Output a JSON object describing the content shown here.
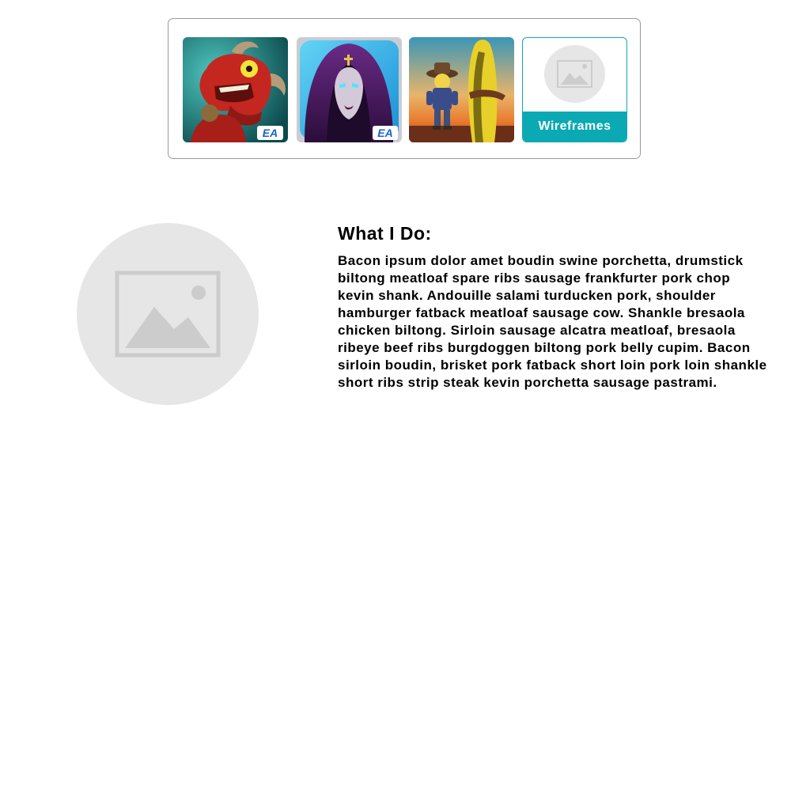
{
  "portfolio": {
    "tiles": [
      {
        "icon": "red-demon-game-icon",
        "badge": "EA"
      },
      {
        "icon": "hooded-woman-game-icon",
        "badge": "EA"
      },
      {
        "icon": "cowboy-game-icon"
      },
      {
        "icon": "image-placeholder-icon",
        "label": "Wireframes"
      }
    ]
  },
  "about": {
    "heading": "What I Do:",
    "body": "Bacon ipsum dolor amet boudin swine porchetta, drumstick biltong meatloaf spare ribs sausage frankfurter pork chop kevin shank. Andouille salami turducken pork, shoulder hamburger fatback meatloaf sausage cow. Shankle bresaola chicken biltong. Sirloin sausage alcatra meatloaf, bresaola ribeye beef ribs burgdoggen biltong pork belly cupim. Bacon sirloin boudin, brisket pork fatback short loin pork loin shankle short ribs strip steak kevin porchetta sausage pastrami."
  },
  "colors": {
    "accent": "#0aa9b4",
    "placeholder": "#e6e6e6",
    "placeholder_glyph": "#cccccc",
    "border": "#9a9a9a"
  }
}
